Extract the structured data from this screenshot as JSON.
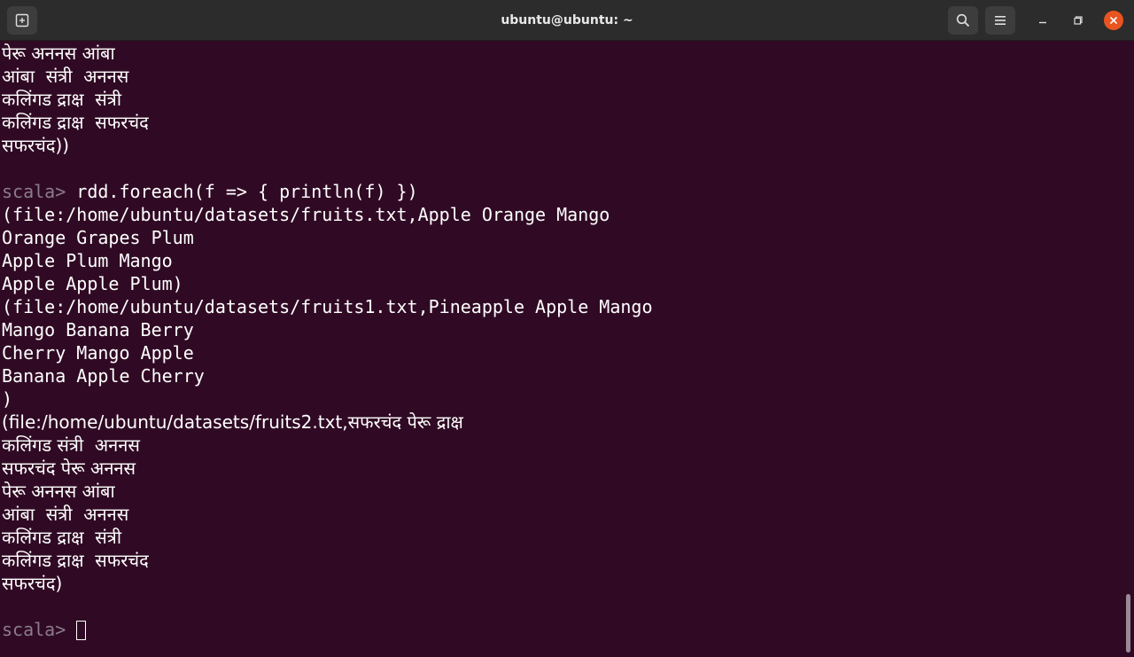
{
  "window": {
    "title": "ubuntu@ubuntu: ~",
    "new_tab_icon": "new-tab-icon",
    "search_icon": "search-icon",
    "menu_icon": "hamburger-menu-icon",
    "minimize_icon": "minimize-icon",
    "maximize_icon": "maximize-icon",
    "close_icon": "close-icon",
    "close_color": "#e95420"
  },
  "terminal": {
    "background": "#300a24",
    "prompt_color": "#8b7b8c",
    "lines": [
      {
        "text": "पेरू अननस आंबा"
      },
      {
        "text": "आंबा  संत्री  अननस"
      },
      {
        "text": "कलिंगड द्राक्ष  संत्री"
      },
      {
        "text": "कलिंगड द्राक्ष  सफरचंद"
      },
      {
        "text": "सफरचंद))"
      },
      {
        "text": ""
      },
      {
        "prompt": "scala> ",
        "text": "rdd.foreach(f => { println(f) })"
      },
      {
        "text": "(file:/home/ubuntu/datasets/fruits.txt,Apple Orange Mango"
      },
      {
        "text": "Orange Grapes Plum"
      },
      {
        "text": "Apple Plum Mango"
      },
      {
        "text": "Apple Apple Plum)"
      },
      {
        "text": "(file:/home/ubuntu/datasets/fruits1.txt,Pineapple Apple Mango"
      },
      {
        "text": "Mango Banana Berry"
      },
      {
        "text": "Cherry Mango Apple"
      },
      {
        "text": "Banana Apple Cherry"
      },
      {
        "text": ")"
      },
      {
        "text": "(file:/home/ubuntu/datasets/fruits2.txt,सफरचंद पेरू द्राक्ष"
      },
      {
        "text": "कलिंगड संत्री  अननस"
      },
      {
        "text": "सफरचंद पेरू अननस"
      },
      {
        "text": "पेरू अननस आंबा"
      },
      {
        "text": "आंबा  संत्री  अननस"
      },
      {
        "text": "कलिंगड द्राक्ष  संत्री"
      },
      {
        "text": "कलिंगड द्राक्ष  सफरचंद"
      },
      {
        "text": "सफरचंद)"
      },
      {
        "text": ""
      },
      {
        "prompt": "scala> ",
        "text": "",
        "cursor": true
      }
    ]
  }
}
